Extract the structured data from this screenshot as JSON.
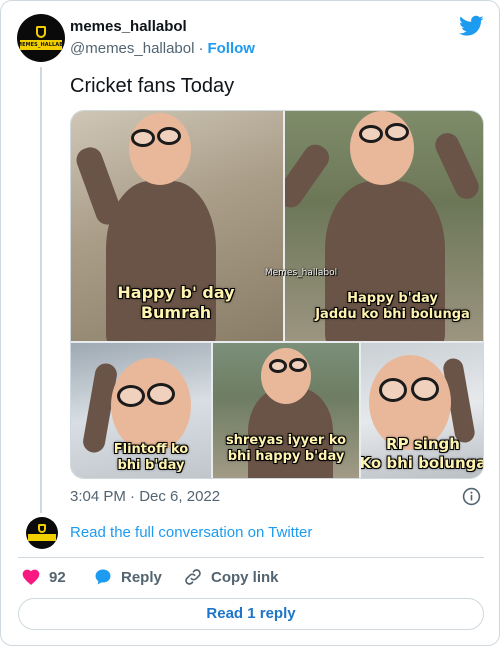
{
  "author": {
    "name": "memes_hallabol",
    "handle": "@memes_hallabol",
    "separator": "·",
    "follow_label": "Follow",
    "avatar_text": "MEMES_HALLABOL"
  },
  "tweet": {
    "text": "Cricket fans Today",
    "watermark": "Memes_hallabol",
    "captions": [
      "Happy b' day\nBumrah",
      "Happy b'day\nJaddu ko bhi bolunga",
      "Flintoff ko\nbhi b'day",
      "shreyas  iyyer ko\nbhi happy b'day",
      "RP singh\nKo bhi bolunga"
    ],
    "time": "3:04 PM",
    "date": "Dec 6, 2022"
  },
  "conversation": {
    "label": "Read the full conversation on Twitter"
  },
  "actions": {
    "likes": "92",
    "reply_label": "Reply",
    "copy_label": "Copy link",
    "read_reply_label": "Read 1 reply"
  },
  "colors": {
    "accent": "#1d9bf0",
    "like": "#f91880",
    "caption": "#fff3b0",
    "border": "#cfd9de"
  },
  "icons": [
    "twitter-bird-icon",
    "info-icon",
    "heart-icon",
    "reply-bubble-icon",
    "link-icon"
  ]
}
